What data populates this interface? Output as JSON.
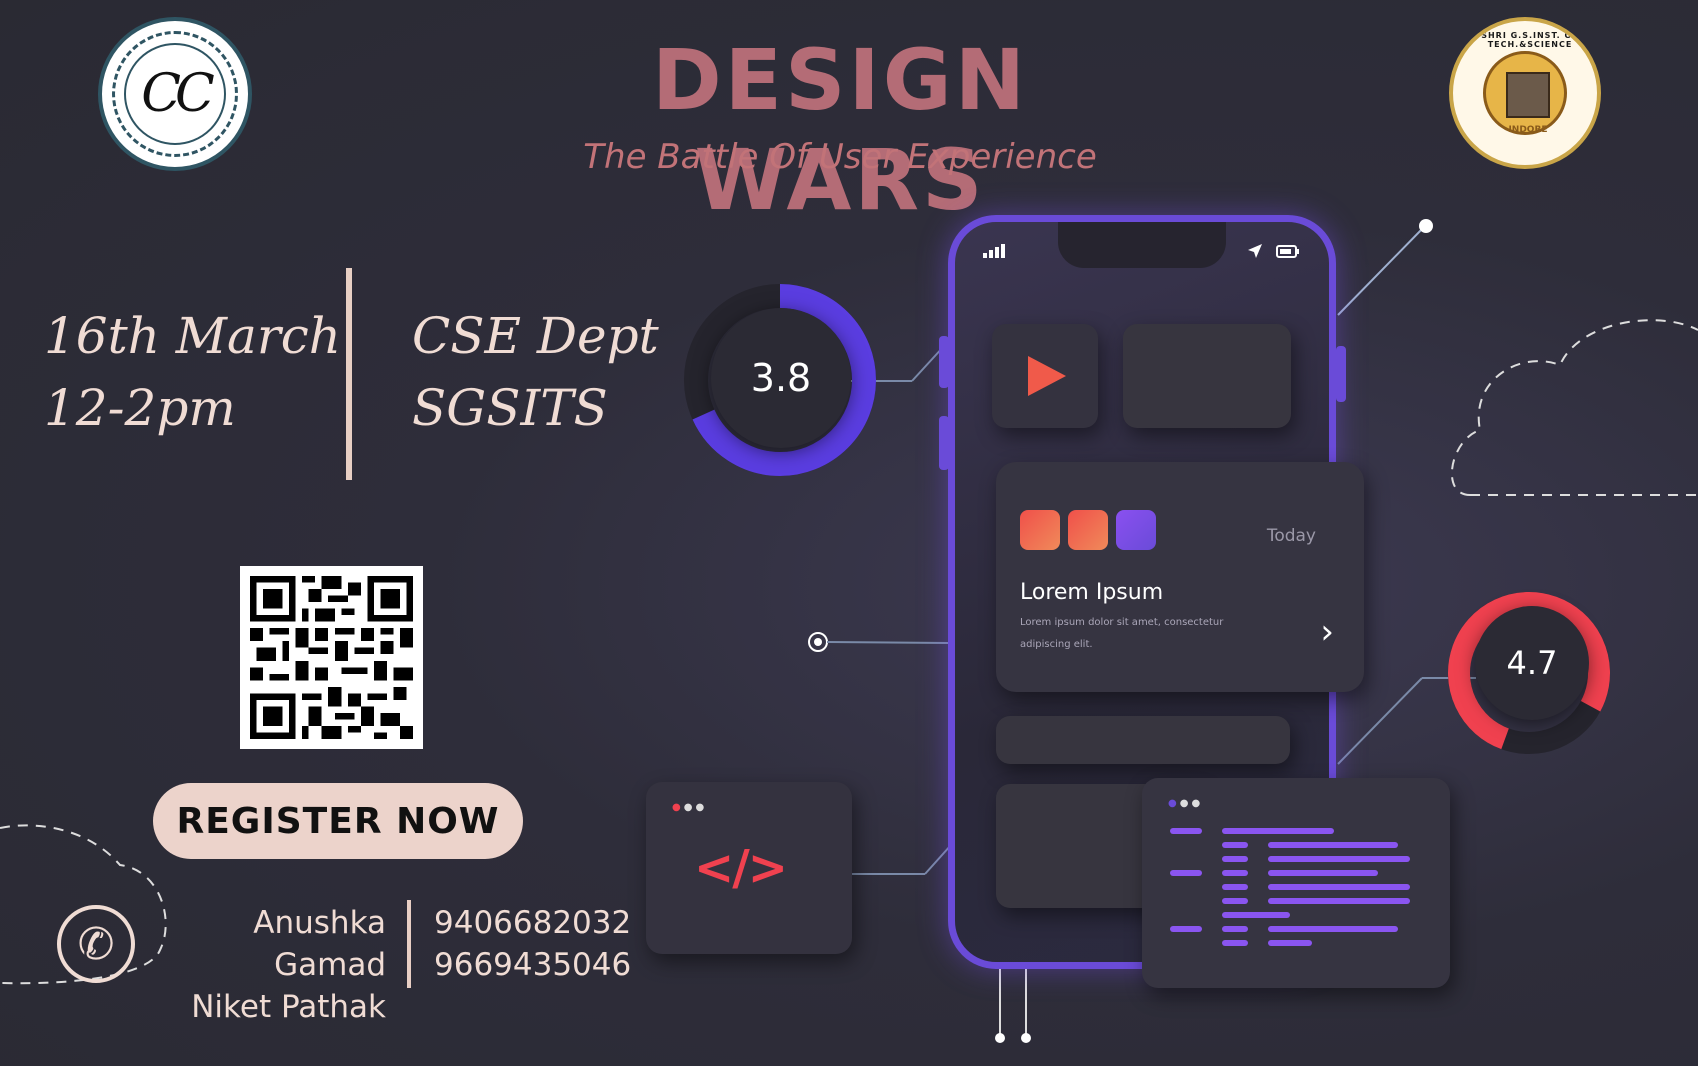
{
  "header": {
    "title": "DESIGN WARS",
    "subtitle": "The Battle  Of User Experience"
  },
  "logos": {
    "left_text": "CC",
    "right_arc_text": "SHRI G.S.INST. OF TECH.&SCIENCE",
    "right_city": "INDORE"
  },
  "event": {
    "date": "16th March",
    "time": "12-2pm",
    "dept": "CSE Dept",
    "institute": "SGSITS"
  },
  "register": {
    "label": "REGISTER NOW"
  },
  "contacts": [
    {
      "name": "Anushka Gamad",
      "phone": "9406682032"
    },
    {
      "name": "Niket Pathak",
      "phone": "9669435046"
    }
  ],
  "mockup": {
    "gauge_left": "3.8",
    "gauge_right": "4.7",
    "card_today": "Today",
    "card_title": "Lorem Ipsum",
    "card_text": "Lorem ipsum dolor sit amet, consectetur adipiscing elit.",
    "code_symbol": "</>"
  },
  "colors": {
    "background": "#2e2d3a",
    "title": "#b46c76",
    "accent_purple": "#6a4bd8",
    "accent_red": "#f0414f",
    "register_bg": "#ecd3cb"
  }
}
